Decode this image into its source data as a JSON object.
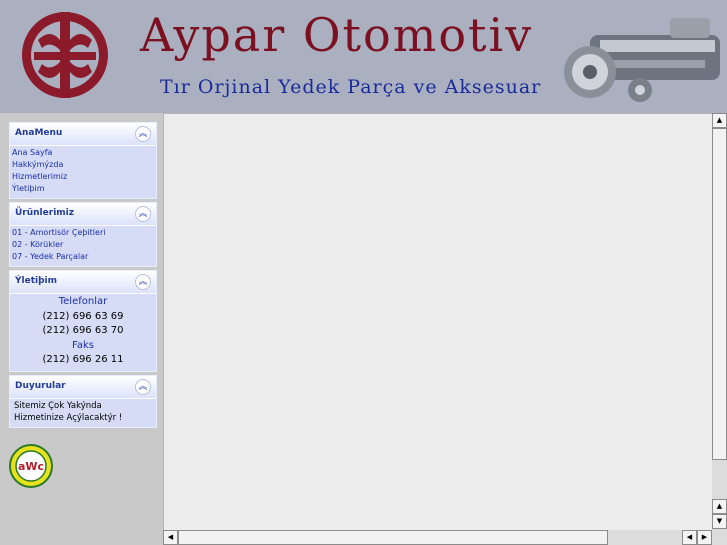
{
  "header": {
    "title": "Aypar Otomotiv",
    "subtitle": "Tır Orjinal Yedek Parça ve Aksesuar",
    "logo_color": "#8b1a2b"
  },
  "colors": {
    "panel_title": "#233c9a",
    "link": "#1a2faa",
    "panel_bg": "#d6dcf5"
  },
  "sidebar": {
    "collapse_icon": "double-chevron-up-icon",
    "panels": [
      {
        "title": "AnaMenu",
        "items": [
          "Ana Sayfa",
          "Hakkýmýzda",
          "Hizmetlerimiz",
          "Ýletiþim"
        ]
      },
      {
        "title": "Ürünlerimiz",
        "items": [
          "01 - Amortisör Çeþitleri",
          "02 - Körükler",
          "07 - Yedek Parçalar"
        ]
      },
      {
        "title": "Ýletiþim",
        "lines": [
          "Telefonlar",
          "(212) 696 63 69",
          "(212) 696 63 70",
          "Faks",
          "(212) 696 26 11"
        ]
      },
      {
        "title": "Duyurular",
        "lines": [
          "Sitemiz Çok Yakýnda",
          "Hizmetinize Açýlacaktýr !"
        ]
      }
    ]
  },
  "badge": {
    "text": "aWc"
  },
  "scrollbars": {
    "up_arrow": "▲",
    "down_arrow": "▼",
    "left_arrow": "◀",
    "right_arrow": "▶"
  }
}
